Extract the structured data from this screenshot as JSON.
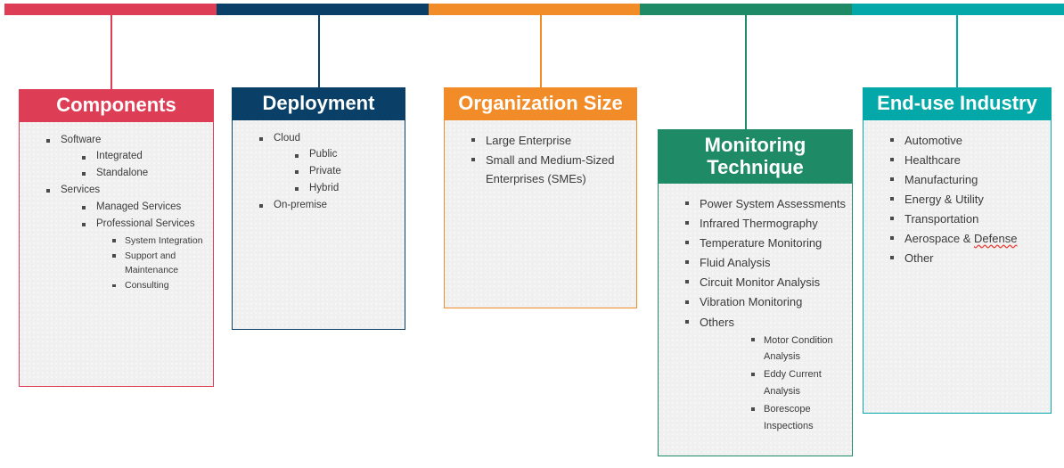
{
  "colors": {
    "components": "#dd3d55",
    "deployment": "#0a4068",
    "organization_size": "#f28c28",
    "monitoring_technique": "#1f8a66",
    "end_use_industry": "#04a8a8",
    "panel_body_background": "#f0f0f0",
    "text": "#3b3b3b",
    "spellcheck_underline": "#e8443c"
  },
  "topbar": {
    "segments": [
      {
        "name": "components-segment",
        "color": "#dd3d55"
      },
      {
        "name": "deployment-segment",
        "color": "#0a4068"
      },
      {
        "name": "organization-size-segment",
        "color": "#f28c28"
      },
      {
        "name": "monitoring-technique-segment",
        "color": "#1f8a66"
      },
      {
        "name": "end-use-industry-segment",
        "color": "#04a8a8"
      }
    ]
  },
  "panels": [
    {
      "key": "components",
      "title": "Components",
      "color": "#dd3d55",
      "items": [
        {
          "level": 1,
          "text": "Software"
        },
        {
          "level": 2,
          "text": "Integrated"
        },
        {
          "level": 2,
          "text": "Standalone"
        },
        {
          "level": 1,
          "text": "Services"
        },
        {
          "level": 2,
          "text": "Managed Services"
        },
        {
          "level": 2,
          "text": "Professional Services"
        },
        {
          "level": 3,
          "text": "System Integration"
        },
        {
          "level": 3,
          "text": "Support and Maintenance"
        },
        {
          "level": 3,
          "text": "Consulting"
        }
      ]
    },
    {
      "key": "deployment",
      "title": "Deployment",
      "color": "#0a4068",
      "items": [
        {
          "level": 1,
          "text": "Cloud"
        },
        {
          "level": 2,
          "text": "Public"
        },
        {
          "level": 2,
          "text": "Private"
        },
        {
          "level": 2,
          "text": "Hybrid"
        },
        {
          "level": 1,
          "text": "On-premise"
        }
      ]
    },
    {
      "key": "organization_size",
      "title": "Organization Size",
      "color": "#f28c28",
      "items": [
        {
          "level": 1,
          "text": "Large Enterprise"
        },
        {
          "level": 1,
          "text": "Small and Medium-Sized Enterprises (SMEs)"
        }
      ]
    },
    {
      "key": "monitoring_technique",
      "title": "Monitoring Technique",
      "color": "#1f8a66",
      "items": [
        {
          "level": 1,
          "text": "Power System Assessments"
        },
        {
          "level": 1,
          "text": "Infrared Thermography"
        },
        {
          "level": 1,
          "text": "Temperature Monitoring"
        },
        {
          "level": 1,
          "text": "Fluid Analysis"
        },
        {
          "level": 1,
          "text": "Circuit Monitor Analysis"
        },
        {
          "level": 1,
          "text": "Vibration Monitoring"
        },
        {
          "level": 1,
          "text": "Others"
        },
        {
          "level": 3,
          "text": "Motor Condition Analysis"
        },
        {
          "level": 3,
          "text": "Eddy Current Analysis"
        },
        {
          "level": 3,
          "text": "Borescope Inspections"
        }
      ]
    },
    {
      "key": "end_use_industry",
      "title": "End-use Industry",
      "color": "#04a8a8",
      "items": [
        {
          "level": 1,
          "text": "Automotive"
        },
        {
          "level": 1,
          "text": "Healthcare"
        },
        {
          "level": 1,
          "text": "Manufacturing"
        },
        {
          "level": 1,
          "text": "Energy & Utility"
        },
        {
          "level": 1,
          "text": "Transportation"
        },
        {
          "level": 1,
          "text": "Aerospace & Defense",
          "misspelled_word": "Defense"
        },
        {
          "level": 1,
          "text": "Other"
        }
      ]
    }
  ]
}
